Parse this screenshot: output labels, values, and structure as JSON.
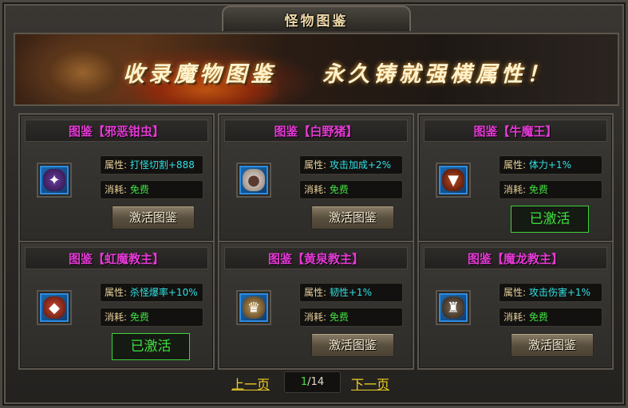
{
  "window": {
    "title": "怪物图鉴"
  },
  "banner": {
    "left_text": "收录魔物图鉴",
    "right_text": "永久铸就强横属性！"
  },
  "labels": {
    "attr": "属性:",
    "cost": "消耗:"
  },
  "cards": [
    {
      "name": "图鉴【邪恶钳虫】",
      "attr": "打怪切割+888",
      "cost": "免费",
      "button": "激活图鉴",
      "activated": false,
      "icon": "pincer-bug-icon"
    },
    {
      "name": "图鉴【白野猪】",
      "attr": "攻击加成+2%",
      "cost": "免费",
      "button": "激活图鉴",
      "activated": false,
      "icon": "white-boar-icon"
    },
    {
      "name": "图鉴【牛魔王】",
      "attr": "体力+1%",
      "cost": "免费",
      "button": "已激活",
      "activated": true,
      "icon": "bull-demon-king-icon"
    },
    {
      "name": "图鉴【虹魔教主】",
      "attr": "杀怪爆率+10%",
      "cost": "免费",
      "button": "已激活",
      "activated": true,
      "icon": "rainbow-demon-master-icon"
    },
    {
      "name": "图鉴【黄泉教主】",
      "attr": "韧性+1%",
      "cost": "免费",
      "button": "激活图鉴",
      "activated": false,
      "icon": "netherworld-master-icon"
    },
    {
      "name": "图鉴【魔龙教主】",
      "attr": "攻击伤害+1%",
      "cost": "免费",
      "button": "激活图鉴",
      "activated": false,
      "icon": "demon-dragon-master-icon"
    }
  ],
  "pager": {
    "prev": "上一页",
    "next": "下一页",
    "current": "1",
    "total": "/14"
  },
  "colors": {
    "title_magenta": "#e63ad6",
    "attr_cyan": "#30e0e0",
    "cost_green": "#40e040",
    "pager_yellow": "#f0d020"
  }
}
